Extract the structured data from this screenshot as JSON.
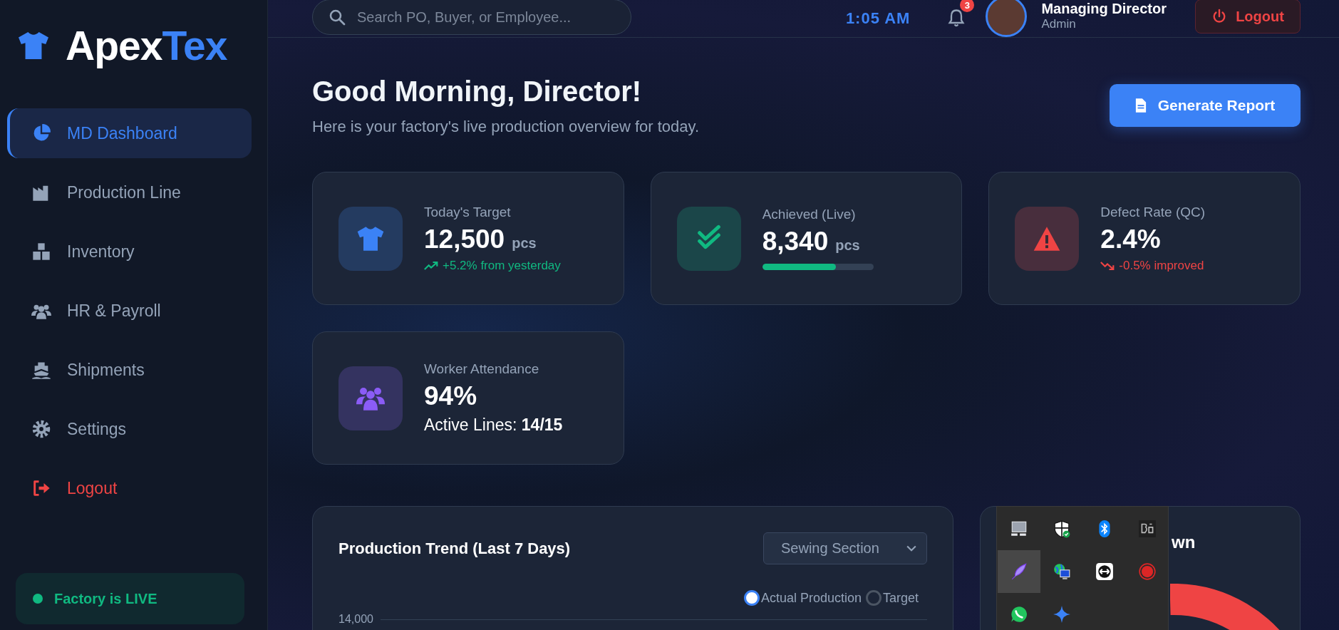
{
  "brand": {
    "name_main": "Apex",
    "name_accent": "Tex"
  },
  "sidebar": {
    "items": [
      {
        "label": "MD Dashboard",
        "kind": "nav",
        "selected": true
      },
      {
        "label": "Production Line",
        "kind": "nav",
        "selected": false
      },
      {
        "label": "Inventory",
        "kind": "nav",
        "selected": false
      },
      {
        "label": "HR & Payroll",
        "kind": "nav",
        "selected": false
      },
      {
        "label": "Shipments",
        "kind": "nav",
        "selected": false
      },
      {
        "label": "Settings",
        "kind": "nav",
        "selected": false
      },
      {
        "label": "Logout",
        "kind": "logout",
        "selected": false
      }
    ],
    "status": {
      "label": "Factory is LIVE",
      "on": true
    }
  },
  "topbar": {
    "search": {
      "placeholder": "Search PO, Buyer, or Employee..."
    },
    "time": "1:05 AM",
    "notifications": {
      "count": "3"
    },
    "user": {
      "name": "Managing Director",
      "role": "Admin"
    },
    "logout": "Logout"
  },
  "header": {
    "greeting": "Good Morning, Director!",
    "subtitle": "Here is your factory's live production overview for today.",
    "action": "Generate Report"
  },
  "stats": [
    {
      "kind": "target",
      "color": "#3b82f6",
      "label": "Today's Target",
      "value": "12,500",
      "unit": "pcs",
      "trend": {
        "kind": "up",
        "text": "+5.2% from yesterday"
      }
    },
    {
      "kind": "achieved",
      "color": "#10b981",
      "label": "Achieved (Live)",
      "value": "8,340",
      "unit": "pcs",
      "level": 0.66
    },
    {
      "kind": "defect",
      "color": "#ef4444",
      "label": "Defect Rate (QC)",
      "value": "2.4%",
      "trend": {
        "kind": "down",
        "text": "-0.5% improved"
      }
    },
    {
      "kind": "attendance",
      "color": "#8b5cf6",
      "label": "Worker Attendance",
      "value": "94%",
      "detail": "Active Lines: **14/15**"
    }
  ],
  "trend_panel": {
    "title": "Production Trend (Last 7 Days)",
    "section_select": {
      "value": "Sewing Section"
    },
    "legend": [
      {
        "label": "Actual Production",
        "selected": true
      },
      {
        "label": "Target",
        "selected": false
      }
    ],
    "y_tick": "14,000"
  },
  "breakdown_panel": {
    "title_visible": "wn"
  },
  "tray": {
    "icons": [
      {
        "selected": false
      },
      {
        "selected": false
      },
      {
        "selected": false
      },
      {
        "selected": false
      },
      {
        "selected": true
      },
      {
        "selected": false
      },
      {
        "selected": false
      },
      {
        "selected": false
      },
      {
        "selected": false
      },
      {
        "selected": false
      }
    ]
  }
}
